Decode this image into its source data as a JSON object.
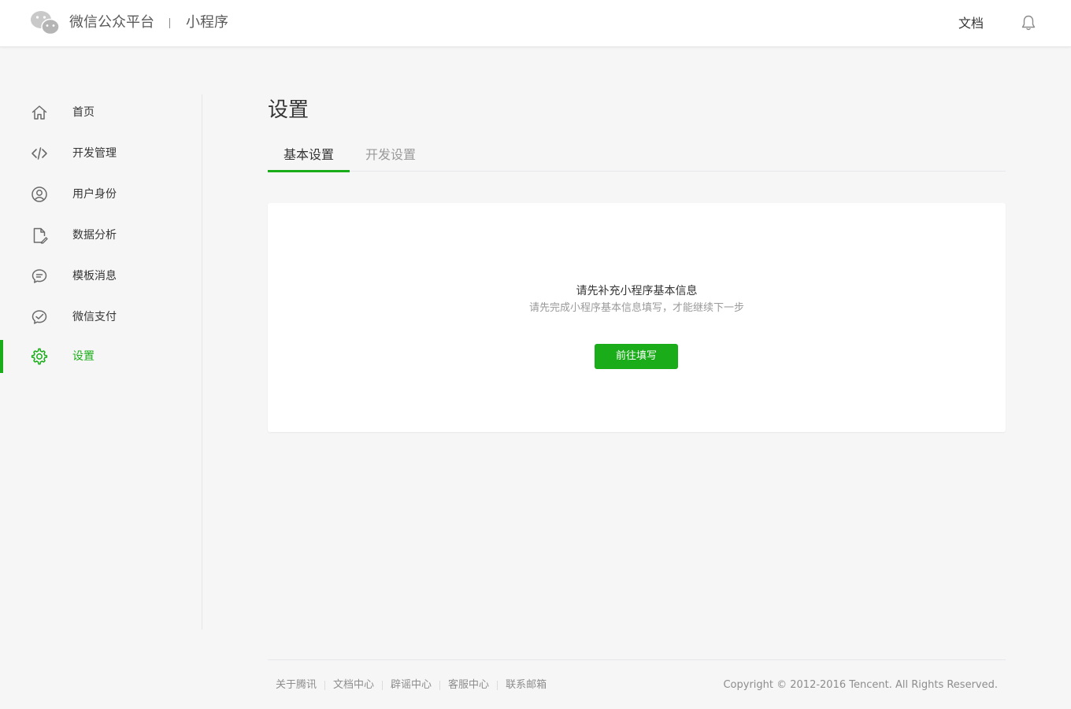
{
  "header": {
    "brand_name": "微信公众平台",
    "brand_sub": "小程序",
    "docs_label": "文档"
  },
  "sidebar": {
    "items": [
      {
        "label": "首页",
        "icon": "home-icon"
      },
      {
        "label": "开发管理",
        "icon": "code-icon"
      },
      {
        "label": "用户身份",
        "icon": "user-icon"
      },
      {
        "label": "数据分析",
        "icon": "document-chart-icon"
      },
      {
        "label": "模板消息",
        "icon": "chat-bubble-icon"
      },
      {
        "label": "微信支付",
        "icon": "wechat-pay-icon"
      },
      {
        "label": "设置",
        "icon": "gear-icon",
        "active": true
      }
    ]
  },
  "main": {
    "title": "设置",
    "tabs": [
      {
        "label": "基本设置",
        "active": true
      },
      {
        "label": "开发设置",
        "active": false
      }
    ],
    "card": {
      "title": "请先补充小程序基本信息",
      "description": "请先完成小程序基本信息填写，才能继续下一步",
      "button_label": "前往填写"
    }
  },
  "footer": {
    "links": [
      "关于腾讯",
      "文档中心",
      "辟谣中心",
      "客服中心",
      "联系邮箱"
    ],
    "copyright": "Copyright © 2012-2016 Tencent. All Rights Reserved."
  },
  "colors": {
    "accent": "#1aad19",
    "background": "#f6f6f6",
    "text": "#353535",
    "muted": "#9a9a9a"
  }
}
